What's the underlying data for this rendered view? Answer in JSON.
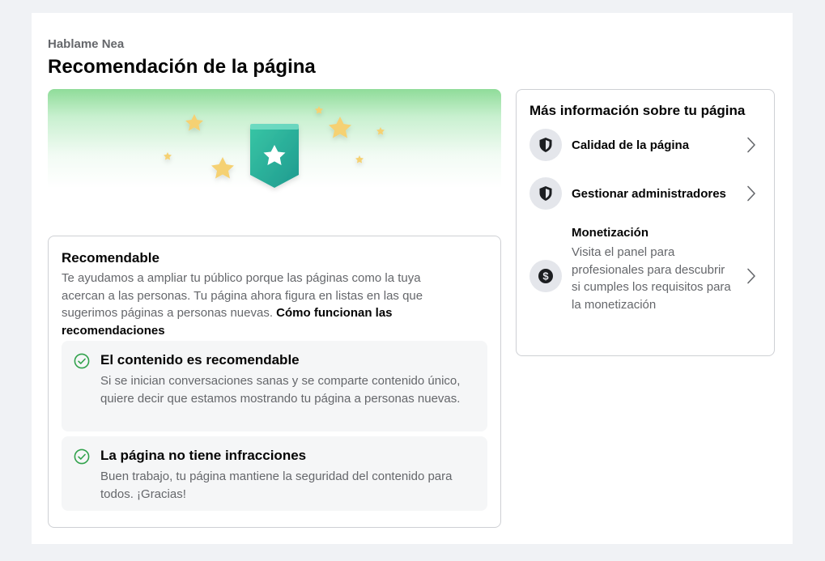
{
  "header": {
    "page_name": "Hablame Nea",
    "title": "Recomendación de la página"
  },
  "recommendation": {
    "status_title": "Recomendable",
    "description": "Te ayudamos a ampliar tu público porque las páginas como la tuya acercan a las personas. Tu página ahora figura en listas en las que sugerimos páginas a personas nuevas. ",
    "link_label": "Cómo funcionan las recomendaciones",
    "checks": [
      {
        "title": "El contenido es recomendable",
        "description": "Si se inician conversaciones sanas y se comparte contenido único, quiere decir que estamos mostrando tu página a personas nuevas.",
        "icon": "check-circle-icon"
      },
      {
        "title": "La página no tiene infracciones",
        "description": "Buen trabajo, tu página mantiene la seguridad del contenido para todos. ¡Gracias!",
        "icon": "check-circle-icon"
      }
    ]
  },
  "sidebar": {
    "title": "Más información sobre tu página",
    "items": [
      {
        "label": "Calidad de la página",
        "icon": "shield-icon"
      },
      {
        "label": "Gestionar administradores",
        "icon": "shield-icon"
      },
      {
        "label": "Monetización",
        "description": "Visita el panel para profesionales para descubrir si cumples los requisitos para la monetización",
        "icon": "dollar-icon"
      }
    ]
  },
  "colors": {
    "check_green": "#31a24c",
    "badge_teal": "#2bab9a",
    "star_gold": "#f5d173"
  }
}
